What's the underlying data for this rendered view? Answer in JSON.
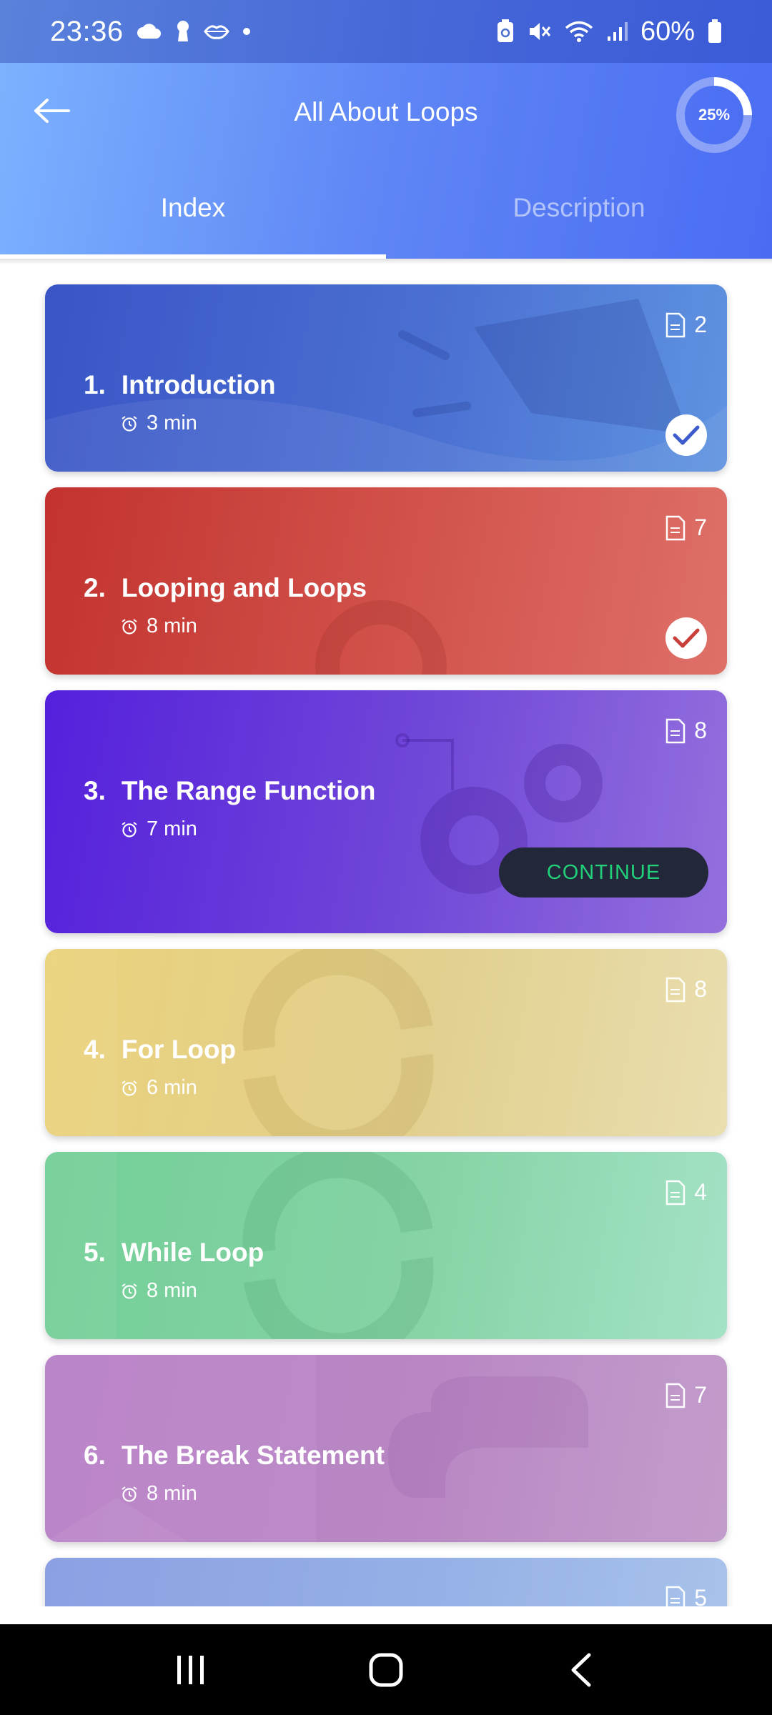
{
  "status_bar": {
    "time": "23:36",
    "battery": "60%",
    "icons": [
      "cloud-icon",
      "keyhole-icon",
      "lips-icon",
      "dot-icon",
      "battery-saver-icon",
      "mute-icon",
      "wifi-icon",
      "signal-icon",
      "battery-icon"
    ]
  },
  "header": {
    "title": "All About Loops",
    "progress_label": "25%",
    "progress_value": 0.25
  },
  "tabs": [
    {
      "label": "Index",
      "active": true
    },
    {
      "label": "Description",
      "active": false
    }
  ],
  "lessons": [
    {
      "number": "1.",
      "title": "Introduction",
      "duration": "3 min",
      "count": "2",
      "status": "completed",
      "color": "#3d5bcc"
    },
    {
      "number": "2.",
      "title": "Looping and Loops",
      "duration": "8 min",
      "count": "7",
      "status": "completed",
      "color": "#c9403b"
    },
    {
      "number": "3.",
      "title": "The Range Function",
      "duration": "7 min",
      "count": "8",
      "status": "in-progress",
      "action_label": "CONTINUE",
      "color": "#5e2fdc"
    },
    {
      "number": "4.",
      "title": "For Loop",
      "duration": "6 min",
      "count": "8",
      "status": "locked",
      "color": "#e9d17f"
    },
    {
      "number": "5.",
      "title": "While Loop",
      "duration": "8 min",
      "count": "4",
      "status": "locked",
      "color": "#7dd39d"
    },
    {
      "number": "6.",
      "title": "The Break Statement",
      "duration": "8 min",
      "count": "7",
      "status": "locked",
      "color": "#bf8ac9"
    },
    {
      "number": "",
      "title": "",
      "duration": "",
      "count": "5",
      "status": "locked",
      "color": "#8fa6e6"
    }
  ],
  "nav": {
    "buttons": [
      "recent-apps-icon",
      "home-icon",
      "back-icon"
    ]
  }
}
